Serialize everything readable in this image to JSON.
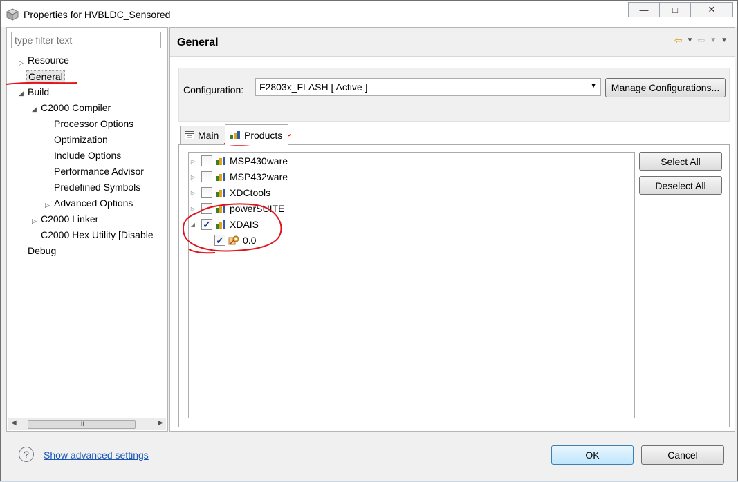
{
  "window": {
    "title": "Properties for HVBLDC_Sensored",
    "controls": {
      "minimize": "—",
      "maximize": "□",
      "close": "✕"
    }
  },
  "sidebar": {
    "filter_placeholder": "type filter text",
    "items": [
      {
        "label": "Resource"
      },
      {
        "label": "General"
      },
      {
        "label": "Build"
      },
      {
        "label": "C2000 Compiler"
      },
      {
        "label": "Processor Options"
      },
      {
        "label": "Optimization"
      },
      {
        "label": "Include Options"
      },
      {
        "label": "Performance Advisor"
      },
      {
        "label": "Predefined Symbols"
      },
      {
        "label": "Advanced Options"
      },
      {
        "label": "C2000 Linker"
      },
      {
        "label": "C2000 Hex Utility  [Disable"
      },
      {
        "label": "Debug"
      }
    ],
    "scrollbar_thumb": "III"
  },
  "main": {
    "title": "General",
    "configuration_label": "Configuration:",
    "configuration_value": "F2803x_FLASH  [ Active ]",
    "manage_button": "Manage Configurations...",
    "tabs": [
      {
        "label": "Main"
      },
      {
        "label": "Products"
      }
    ],
    "products": [
      {
        "label": "MSP430ware",
        "checked": false
      },
      {
        "label": "MSP432ware",
        "checked": false
      },
      {
        "label": "XDCtools",
        "checked": false
      },
      {
        "label": "powerSUITE",
        "checked": false
      },
      {
        "label": "XDAIS",
        "checked": true
      },
      {
        "label": "0.0",
        "checked": true
      }
    ],
    "select_all": "Select All",
    "deselect_all": "Deselect All"
  },
  "footer": {
    "help": "?",
    "advanced_link": "Show advanced settings",
    "ok": "OK",
    "cancel": "Cancel"
  },
  "colors": {
    "annotation": "#e0141b",
    "link": "#1a56b7",
    "check": "#1a3b8f"
  }
}
